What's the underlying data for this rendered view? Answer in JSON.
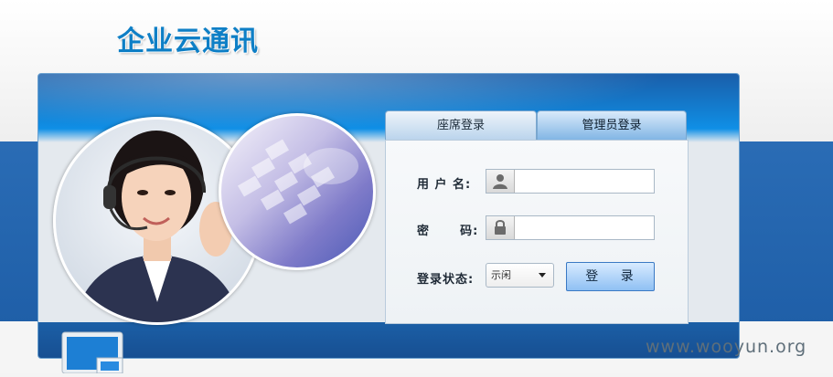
{
  "brand": {
    "title": "企业云通讯"
  },
  "tabs": [
    {
      "label": "座席登录"
    },
    {
      "label": "管理员登录"
    }
  ],
  "form": {
    "username_label": "用 户 名:",
    "username_value": "",
    "password_label": "密      码:",
    "password_value": "",
    "status_label": "登录状态:",
    "status_selected": "示闲",
    "login_button": "登 录"
  },
  "watermark": "www.wooyun.org",
  "colors": {
    "brand": "#0e7fc6",
    "panel_blue": "#1a5ea9",
    "band_blue": "#2a6cb5",
    "button": "#8fc0f3"
  },
  "icons": {
    "username": "user-icon",
    "password": "lock-icon",
    "dropdown": "chevron-down-icon",
    "monitor": "monitor-icon"
  }
}
